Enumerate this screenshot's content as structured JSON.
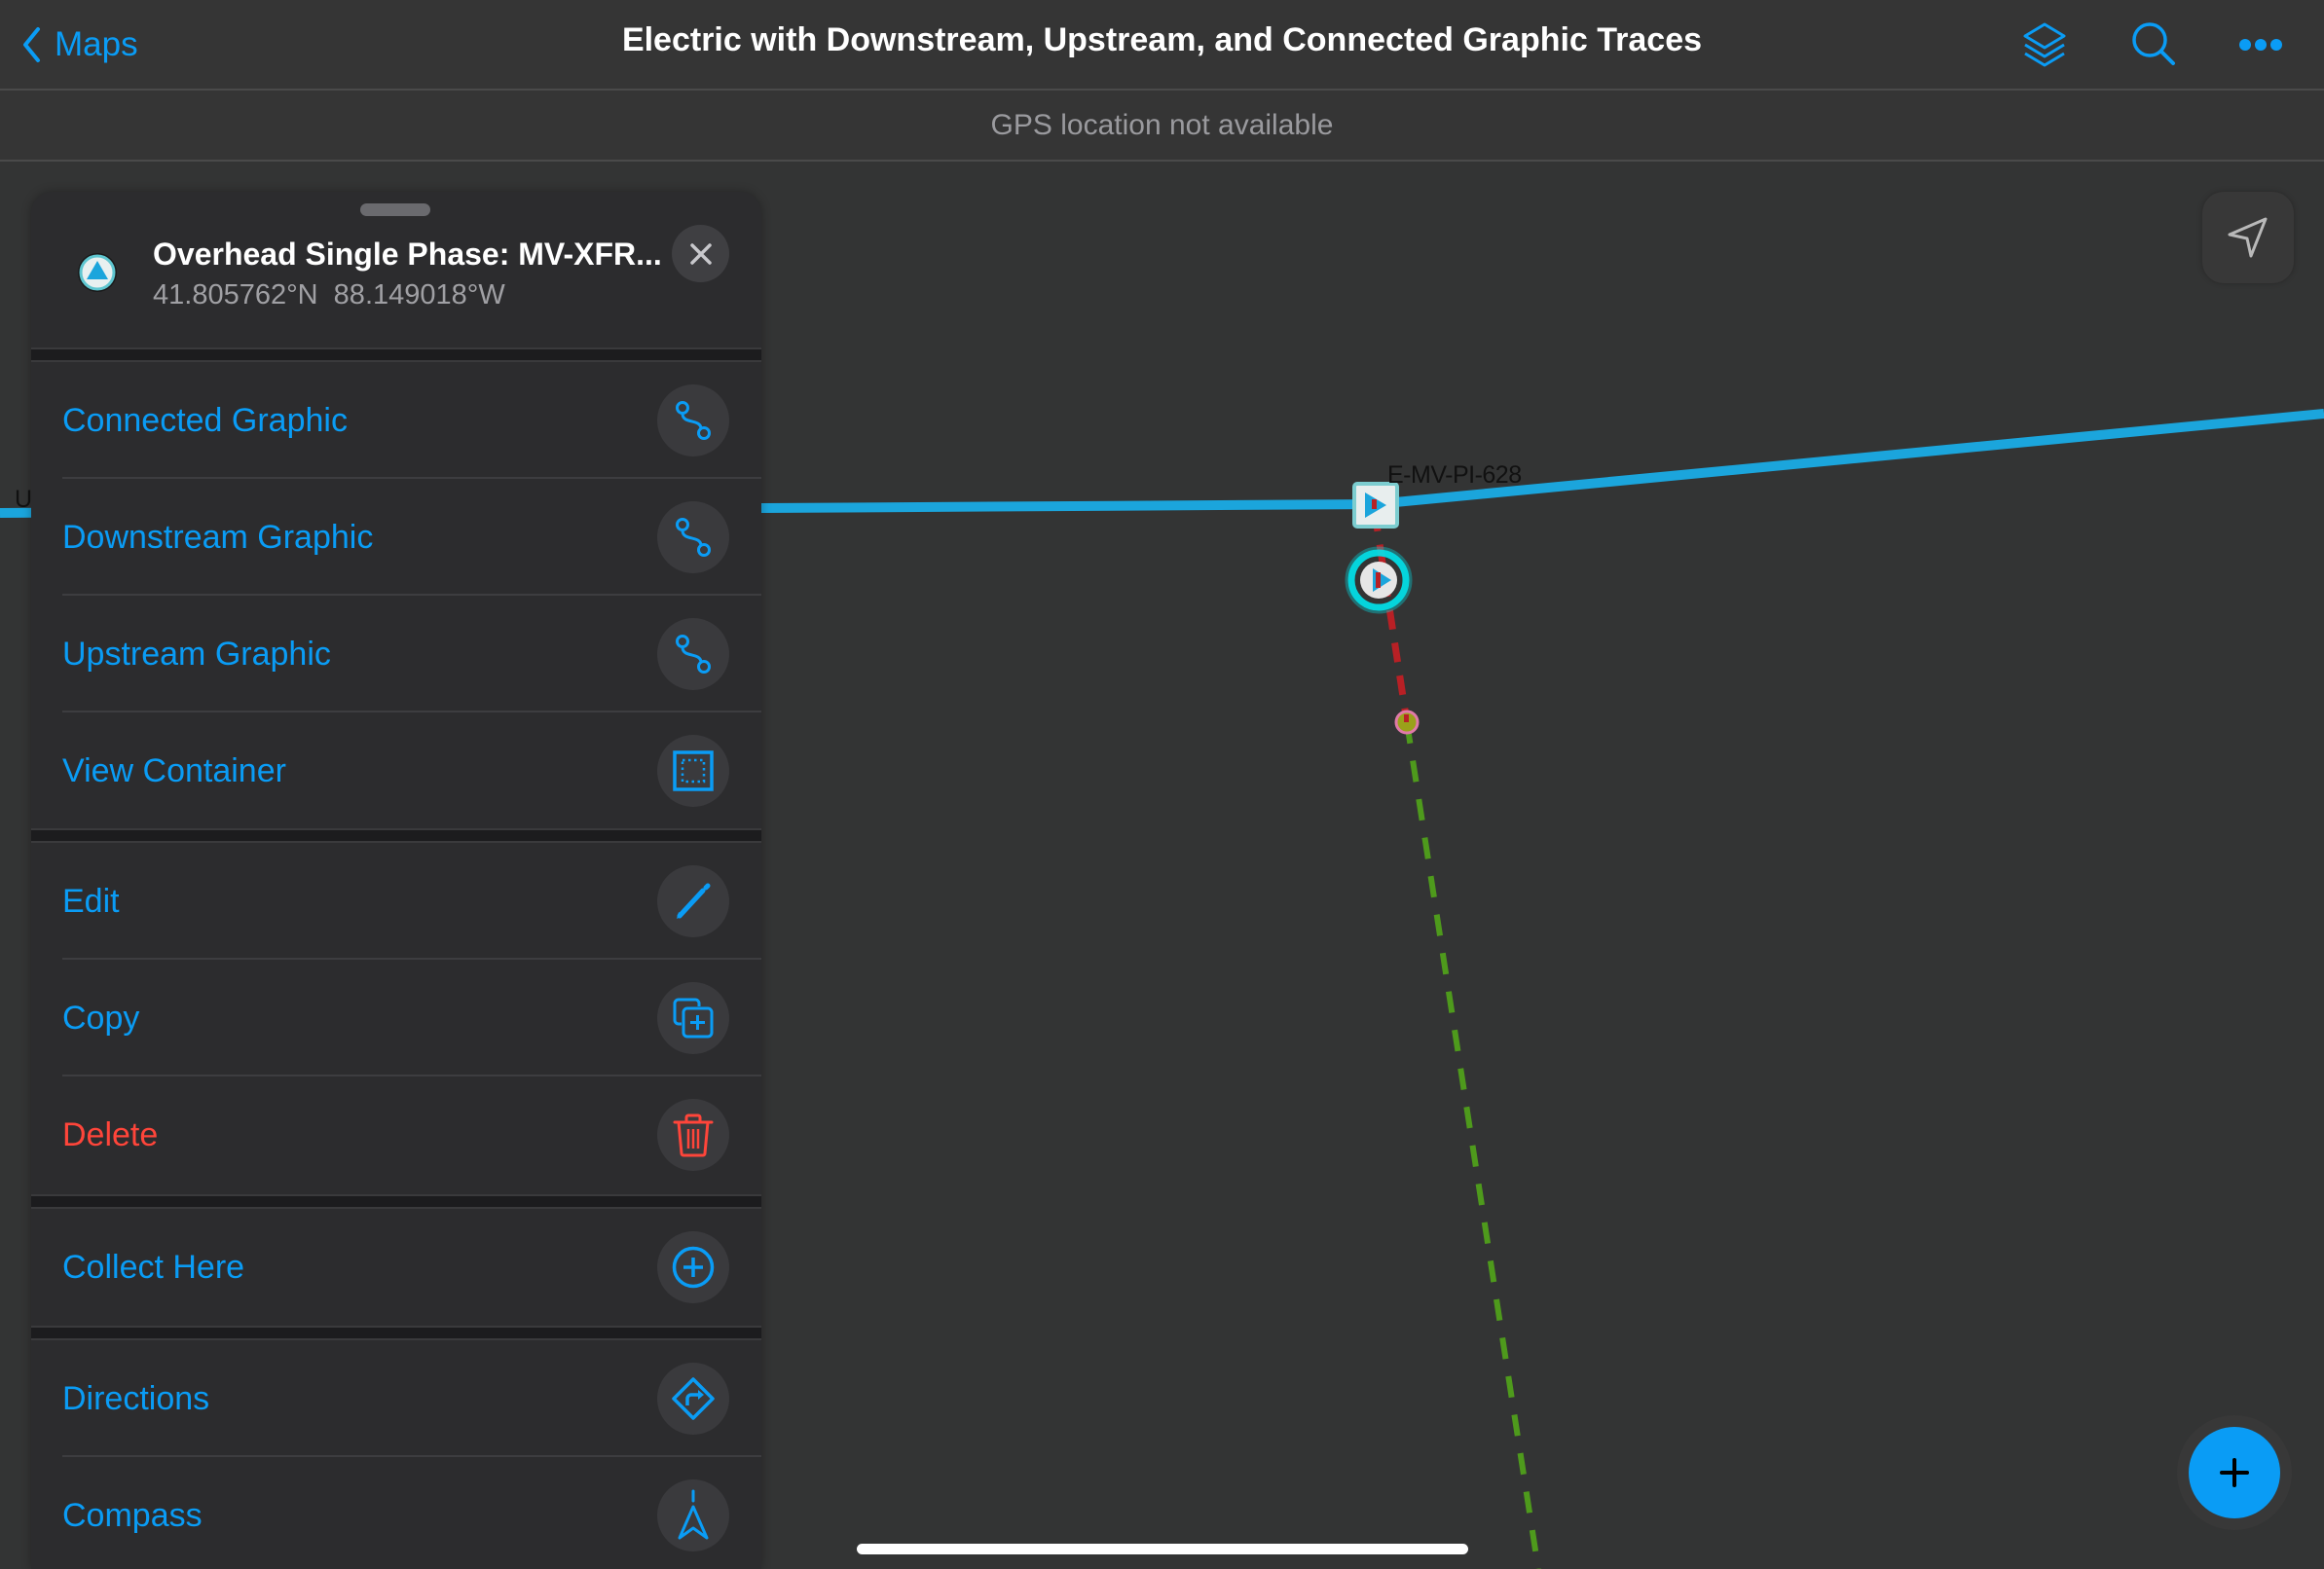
{
  "navbar": {
    "back_label": "Maps",
    "title": "Electric with Downstream, Upstream, and Connected Graphic Traces",
    "icons": [
      "layers-icon",
      "search-icon",
      "more-icon"
    ]
  },
  "status_banner": "GPS location not available",
  "feature_panel": {
    "title": "Overhead Single Phase: MV-XFR...",
    "coordinates": "41.805762°N  88.149018°W",
    "sections": [
      [
        {
          "label": "Connected Graphic",
          "icon": "trace-icon"
        },
        {
          "label": "Downstream Graphic",
          "icon": "trace-icon"
        },
        {
          "label": "Upstream Graphic",
          "icon": "trace-icon"
        },
        {
          "label": "View Container",
          "icon": "container-icon"
        }
      ],
      [
        {
          "label": "Edit",
          "icon": "pencil-icon"
        },
        {
          "label": "Copy",
          "icon": "copy-icon"
        },
        {
          "label": "Delete",
          "icon": "trash-icon",
          "destructive": true
        }
      ],
      [
        {
          "label": "Collect Here",
          "icon": "plus-circle-icon"
        }
      ],
      [
        {
          "label": "Directions",
          "icon": "directions-icon"
        },
        {
          "label": "Compass",
          "icon": "compass-icon"
        }
      ]
    ]
  },
  "map": {
    "labels": {
      "device": "E-MV-PI-628",
      "edge": "U"
    }
  },
  "colors": {
    "accent": "#0a9cf5",
    "destructive": "#ff453a",
    "line_primary": "#1ba5dc",
    "trace_red": "#b82025",
    "trace_green": "#4e9a1c",
    "selection_glow": "#00e5ee"
  }
}
